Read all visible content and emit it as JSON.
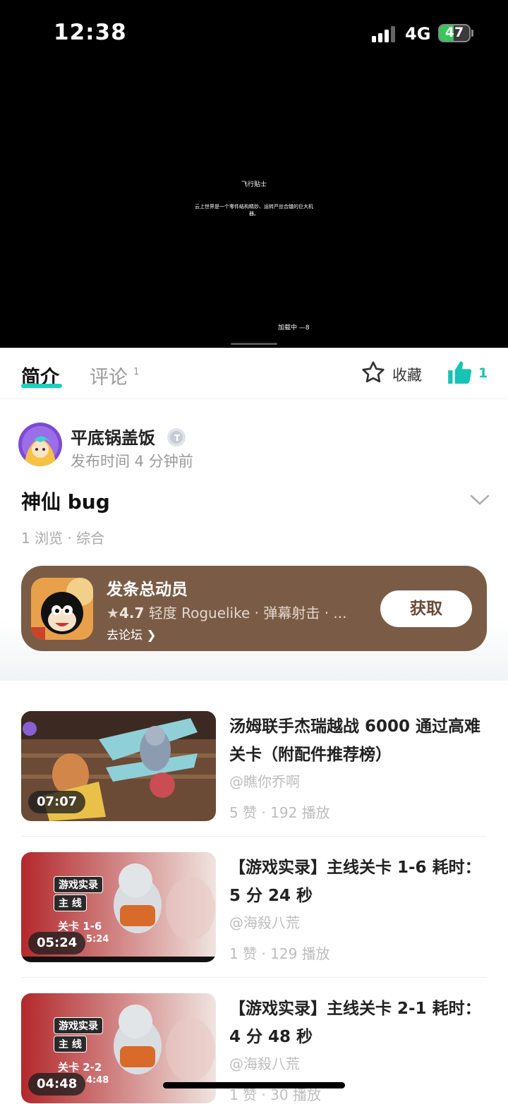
{
  "status_bar": {
    "time": "12:38",
    "network": "4G",
    "battery": "47",
    "battery_level_pct": 47
  },
  "video": {
    "title": "飞行贴士",
    "description": "云上世界是一个零件结构精妙、运转严丝合缝的巨大机器。",
    "loading": "加载中"
  },
  "tabs": {
    "intro": "简介",
    "comments": "评论",
    "comments_count": "1",
    "favorite": "收藏",
    "like_count": "1"
  },
  "post": {
    "author": "平底锅盖饭",
    "publish_time": "发布时间 4 分钟前",
    "title": "神仙 bug",
    "meta": "1 浏览 · 综合"
  },
  "game_card": {
    "name": "发条总动员",
    "rating": "4.7",
    "tags": "轻度 Roguelike · 弹幕射击 · ...",
    "forum_link": "去论坛",
    "get_button": "获取"
  },
  "videos": [
    {
      "duration": "07:07",
      "title": "汤姆联手杰瑞越战 6000 通过高难关卡（附配件推荐榜）",
      "author": "@瞧你乔啊",
      "stats": "5 赞 · 192 播放"
    },
    {
      "duration": "05:24",
      "title": "【游戏实录】主线关卡 1-6 耗时：5 分 24 秒",
      "author": "@海殺八荒",
      "stats": "1 赞 · 129 播放",
      "thumb_tag1": "游戏实录",
      "thumb_tag2": "主 线",
      "thumb_stage": "关卡 1-6",
      "thumb_time": "5:24"
    },
    {
      "duration": "04:48",
      "title": "【游戏实录】主线关卡 2-1 耗时：4 分 48 秒",
      "author": "@海殺八荒",
      "stats": "1 赞 · 30 播放",
      "thumb_tag1": "游戏实录",
      "thumb_tag2": "主 线",
      "thumb_stage": "关卡 2-2",
      "thumb_time": "4:48"
    }
  ],
  "colors": {
    "accent": "#16d1c1",
    "card_bg": "#7a5c46",
    "battery_green": "#34c759"
  }
}
